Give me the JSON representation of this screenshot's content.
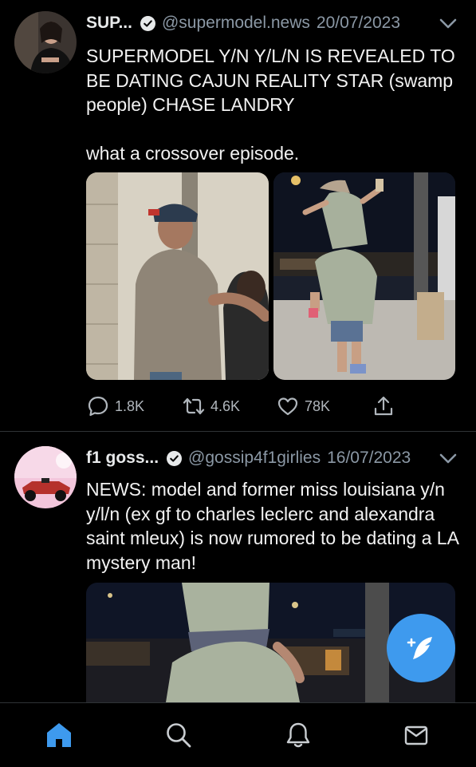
{
  "tweets": [
    {
      "name": "SUP...",
      "handle": "@supermodel.news",
      "date": "20/07/2023",
      "text": "SUPERMODEL Y/N Y/L/N IS REVEALED TO BE DATING CAJUN REALITY STAR (swamp people) CHASE LANDRY\n\nwhat a crossover episode.",
      "images": [
        "couple-by-wall-photo",
        "piggyback-gas-station-photo"
      ],
      "replies": "1.8K",
      "retweets": "4.6K",
      "likes": "78K"
    },
    {
      "name": "f1 goss...",
      "handle": "@gossip4f1girlies",
      "date": "16/07/2023",
      "text": "NEWS: model and former miss louisiana y/n y/l/n (ex gf to charles leclerc and alexandra saint mleux) is now rumored to be dating a LA mystery man!",
      "images": [
        "piggyback-night-photo"
      ]
    }
  ],
  "tabbar": {
    "items": [
      "home-icon",
      "search-icon",
      "notifications-icon",
      "messages-icon"
    ],
    "active": "home-icon"
  },
  "colors": {
    "accent": "#3e9aee",
    "background": "#000000",
    "muted": "#8b98a5"
  }
}
